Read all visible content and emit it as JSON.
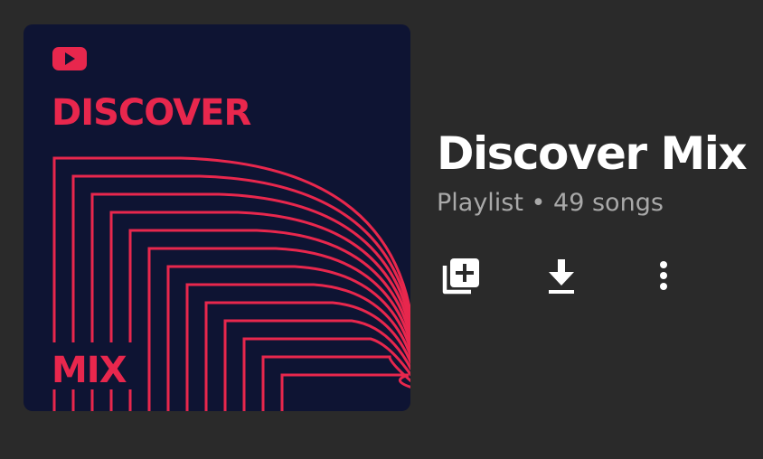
{
  "playlist": {
    "title": "Discover Mix",
    "type": "Playlist",
    "separator": "•",
    "song_count": "49 songs",
    "subtitle": "Playlist • 49 songs"
  },
  "cover_art": {
    "top_text": "DISCOVER",
    "bottom_text": "MIX",
    "background_color": "#0e1433",
    "accent_color": "#e8274d",
    "logo_icon": "youtube-play-icon"
  },
  "actions": [
    {
      "name": "add-to-library",
      "icon": "library-add-icon"
    },
    {
      "name": "download",
      "icon": "download-icon"
    },
    {
      "name": "more-options",
      "icon": "more-vert-icon"
    }
  ]
}
